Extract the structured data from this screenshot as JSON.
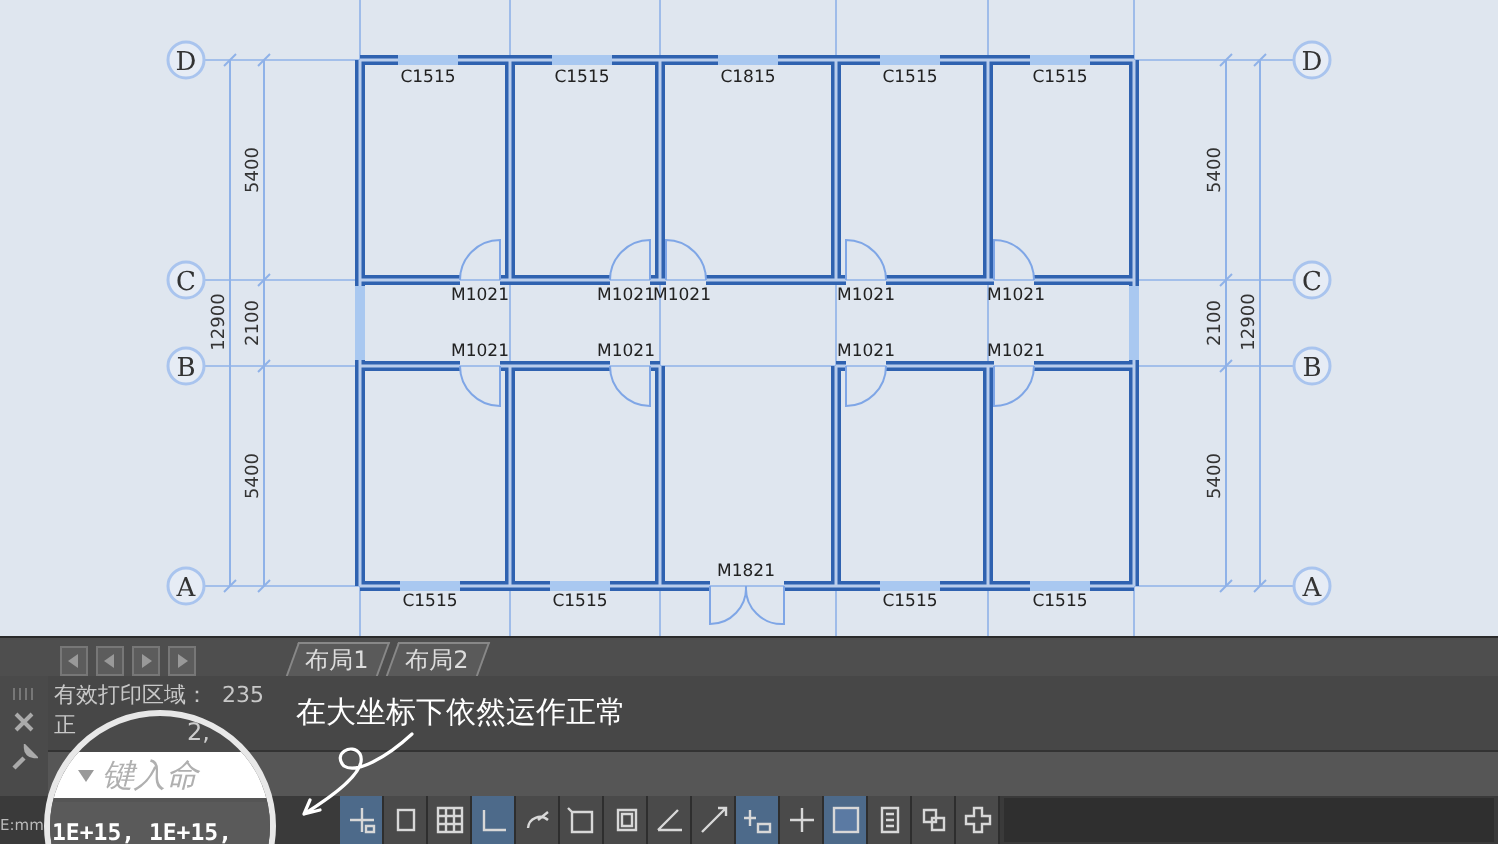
{
  "drawing": {
    "axes_left": [
      "D",
      "C",
      "B",
      "A"
    ],
    "axes_right": [
      "D",
      "C",
      "B",
      "A"
    ],
    "dims_left": {
      "total": "12900",
      "spans": [
        "5400",
        "2100",
        "5400"
      ]
    },
    "dims_right": {
      "total": "12900",
      "spans": [
        "5400",
        "2100",
        "5400"
      ]
    },
    "top_windows": [
      "C1515",
      "C1515",
      "C1815",
      "C1515",
      "C1515"
    ],
    "upper_doors": [
      "M1021",
      "M1021",
      "M1021",
      "M1021",
      "M1021"
    ],
    "lower_doors": [
      "M1021",
      "M1021",
      "M1021",
      "M1021"
    ],
    "entrance_door": "M1821",
    "bottom_windows": [
      "C1515",
      "C1515",
      "C1515",
      "C1515"
    ]
  },
  "layout_tabs": [
    {
      "label": "布局1",
      "selected": false
    },
    {
      "label": "布局2",
      "selected": false
    }
  ],
  "command_history": [
    "有效打印区域：  235",
    "正"
  ],
  "magnifier": {
    "history_fragment": "2,",
    "placeholder": "键入命",
    "coordinates": "1E+15, 1E+15,"
  },
  "annotation": "在大坐标下依然运作正常",
  "status_bar": {
    "units": "E:mm",
    "toggles": [
      {
        "on": true
      },
      {
        "on": false
      },
      {
        "on": false
      },
      {
        "on": true
      },
      {
        "on": false
      },
      {
        "on": false
      },
      {
        "on": false
      },
      {
        "on": false
      },
      {
        "on": false
      },
      {
        "on": true
      },
      {
        "on": false
      },
      {
        "on": true
      },
      {
        "on": false
      },
      {
        "on": false
      },
      {
        "on": false
      }
    ]
  }
}
